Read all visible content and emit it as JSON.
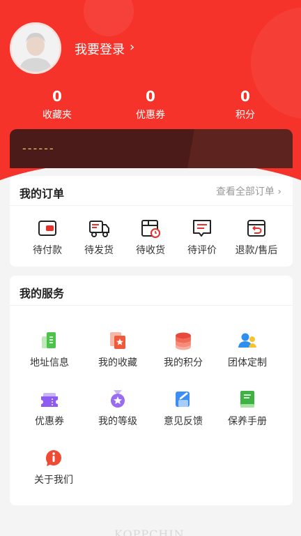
{
  "header": {
    "login_text": "我要登录",
    "chevron": "›",
    "stats": [
      {
        "value": "0",
        "label": "收藏夹"
      },
      {
        "value": "0",
        "label": "优惠券"
      },
      {
        "value": "0",
        "label": "积分"
      }
    ]
  },
  "member_card": {
    "placeholder": "------"
  },
  "orders": {
    "title": "我的订单",
    "view_all": "查看全部订单",
    "items": [
      {
        "label": "待付款",
        "icon": "wallet-icon"
      },
      {
        "label": "待发货",
        "icon": "truck-icon"
      },
      {
        "label": "待收货",
        "icon": "package-clock-icon"
      },
      {
        "label": "待评价",
        "icon": "comment-icon"
      },
      {
        "label": "退款/售后",
        "icon": "refund-box-icon"
      }
    ]
  },
  "services": {
    "title": "我的服务",
    "items": [
      {
        "label": "地址信息",
        "icon": "address-icon"
      },
      {
        "label": "我的收藏",
        "icon": "favorite-icon"
      },
      {
        "label": "我的积分",
        "icon": "points-icon"
      },
      {
        "label": "团体定制",
        "icon": "group-icon"
      },
      {
        "label": "优惠券",
        "icon": "coupon-icon"
      },
      {
        "label": "我的等级",
        "icon": "medal-icon"
      },
      {
        "label": "意见反馈",
        "icon": "feedback-icon"
      },
      {
        "label": "保养手册",
        "icon": "manual-icon"
      },
      {
        "label": "关于我们",
        "icon": "info-icon"
      }
    ]
  },
  "footer": {
    "watermark": "KOPPCHIN"
  },
  "colors": {
    "brand_red": "#f5332a",
    "card_dark": "#4a1b18",
    "gold": "#e8c071"
  }
}
